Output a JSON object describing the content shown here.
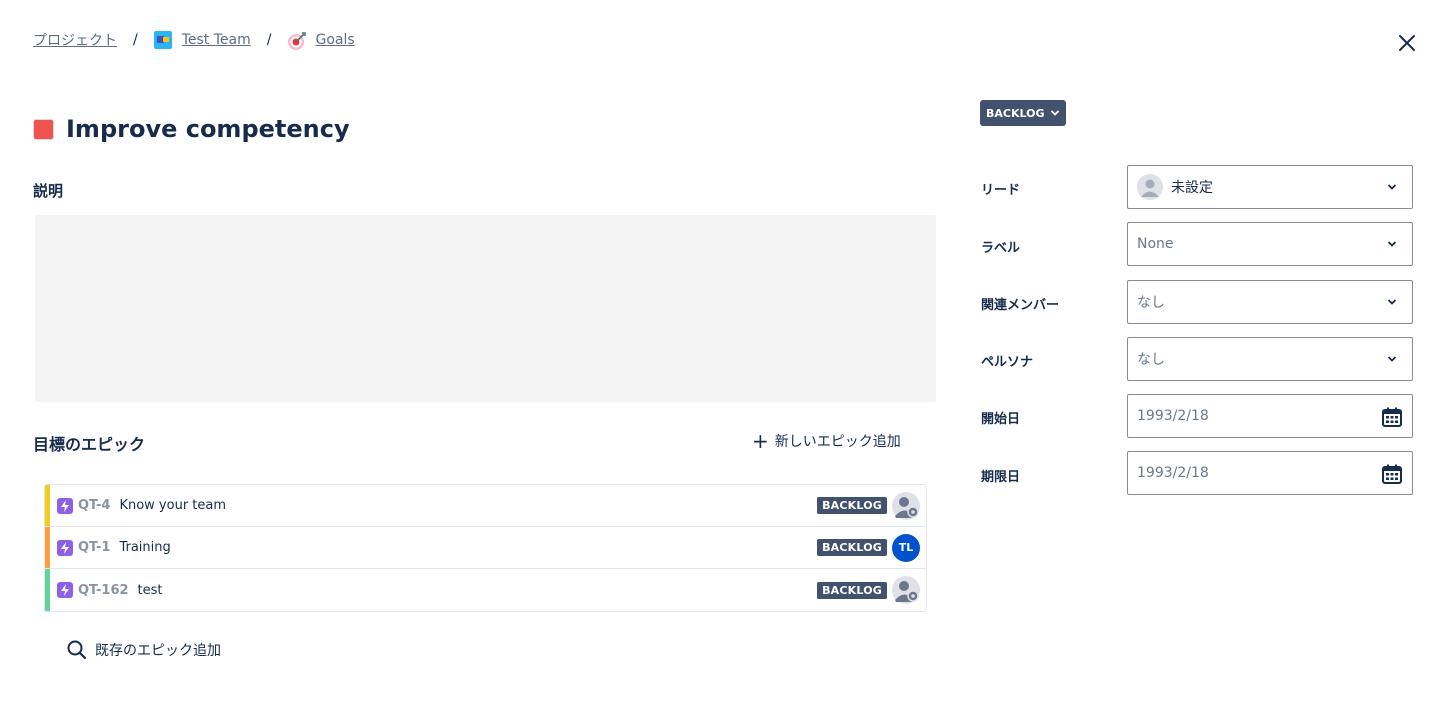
{
  "breadcrumb": {
    "project": "プロジェクト",
    "separator": "/",
    "team": "Test Team",
    "goals": "Goals"
  },
  "goal": {
    "title": "Improve competency",
    "color": "#EF5350",
    "description_label": "説明",
    "description": ""
  },
  "epics": {
    "section_label": "目標のエピック",
    "add_new_label": "新しいエピック追加",
    "add_existing_label": "既存のエピック追加",
    "items": [
      {
        "key": "QT-4",
        "name": "Know your team",
        "status": "BACKLOG",
        "color": "#F5CD19",
        "assignee": "unassigned",
        "assignee_initials": ""
      },
      {
        "key": "QT-1",
        "name": "Training",
        "status": "BACKLOG",
        "color": "#FF9F3F",
        "assignee": "TL",
        "assignee_initials": "TL"
      },
      {
        "key": "QT-162",
        "name": "test",
        "status": "BACKLOG",
        "color": "#5FD59E",
        "assignee": "unassigned",
        "assignee_initials": ""
      }
    ]
  },
  "sidebar": {
    "status": "BACKLOG",
    "fields": {
      "lead": {
        "label": "リード",
        "value": "未設定"
      },
      "label": {
        "label": "ラベル",
        "value": "None"
      },
      "members": {
        "label": "関連メンバー",
        "value": "なし"
      },
      "persona": {
        "label": "ペルソナ",
        "value": "なし"
      },
      "start_date": {
        "label": "開始日",
        "value": "1993/2/18"
      },
      "due_date": {
        "label": "期限日",
        "value": "1993/2/18"
      }
    }
  }
}
